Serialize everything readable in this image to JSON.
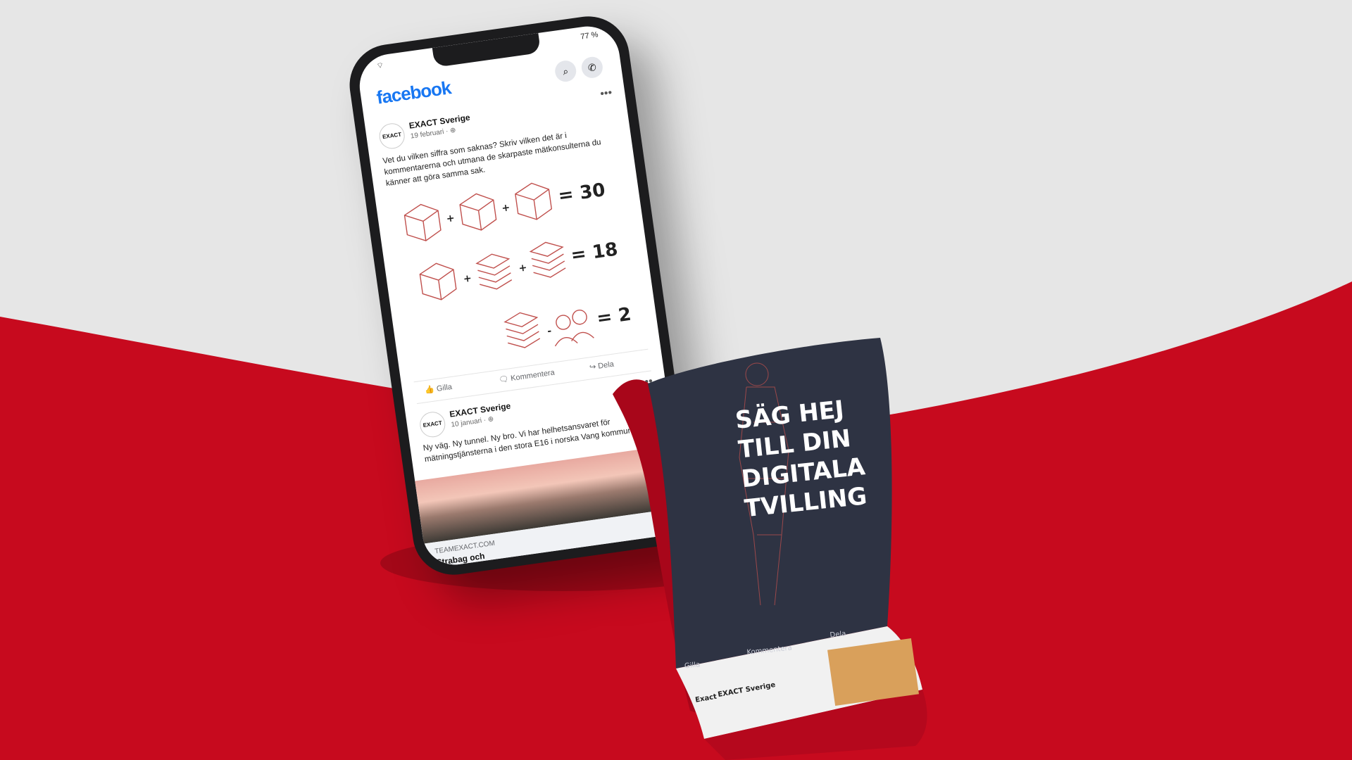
{
  "colors": {
    "brand_red": "#c70a1e",
    "ribbon_navy": "#2e3343",
    "fb_blue": "#1877f2",
    "bg_gray": "#e6e6e6"
  },
  "status": {
    "battery": "77 %"
  },
  "header": {
    "logo": "facebook",
    "search_icon": "search-icon",
    "messenger_icon": "messenger-icon"
  },
  "post1": {
    "author": "EXACT Sverige",
    "avatar_text": "EXACT",
    "date": "19 februari · ⊕",
    "text": "Vet du vilken siffra som saknas? Skriv vilken det är i kommentarerna och utmana de skarpaste mätkonsulterna du känner att göra samma sak.",
    "equations": {
      "eq1_result": "= 30",
      "eq2_result": "= 18",
      "eq3_result": "= 2",
      "plus": "+",
      "minus": "-"
    },
    "actions": {
      "like": "Gilla",
      "comment": "Kommentera",
      "share": "Dela"
    }
  },
  "post2": {
    "author": "EXACT Sverige",
    "avatar_text": "EXACT",
    "date": "10 januari · ⊕",
    "text": "Ny väg. Ny tunnel. Ny bro. Vi har helhetsansvaret för mätningstjänsterna i den stora E16 i norska Vang kommun.",
    "link": {
      "domain": "TEAMEXACT.COM",
      "title": "Strabag och",
      "sub": "Strabag och"
    }
  },
  "ribbon": {
    "headline_lines": [
      "SÄG HEJ",
      "TILL DIN",
      "DIGITALA",
      "TVILLING"
    ],
    "actions": {
      "like": "Gilla",
      "comment": "Kommentera",
      "share": "Dela"
    },
    "post_author": "EXACT Sverige",
    "post_logo": "Exact"
  }
}
